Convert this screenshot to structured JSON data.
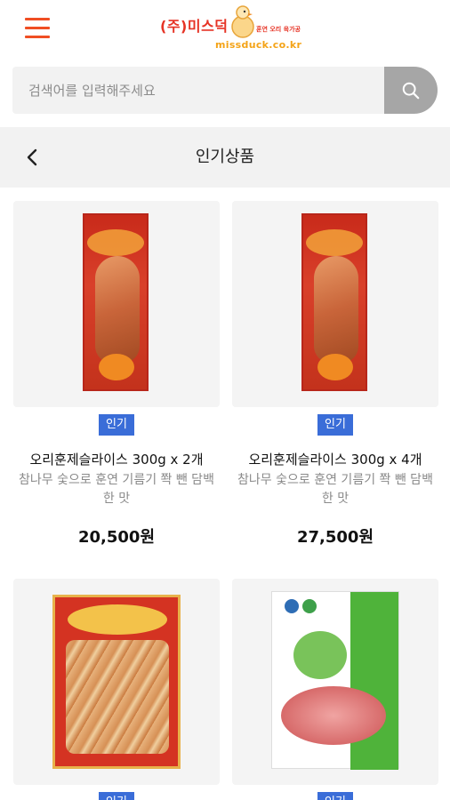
{
  "header": {
    "menu_icon": "hamburger-icon",
    "logo_name": "(주)미스덕",
    "logo_url": "missduck.co.kr",
    "brand_color": "#f04e23"
  },
  "search": {
    "placeholder": "검색어를 입력해주세요",
    "value": "",
    "icon": "search-icon"
  },
  "title_bar": {
    "back_icon": "chevron-left-icon",
    "title": "인기상품"
  },
  "products": [
    {
      "badge": "인기",
      "name": "오리훈제슬라이스 300g x 2개",
      "description": "참나무 숯으로 훈연 기름기 쫙 뺀 담백한 맛",
      "price": "20,500원"
    },
    {
      "badge": "인기",
      "name": "오리훈제슬라이스 300g x 4개",
      "description": "참나무 숯으로 훈연 기름기 쫙 뺀 담백한 맛",
      "price": "27,500원"
    },
    {
      "badge": "인기",
      "name": "",
      "description": "",
      "price": ""
    },
    {
      "badge": "인기",
      "name": "",
      "description": "",
      "price": ""
    }
  ],
  "colors": {
    "badge": "#3a6dd8",
    "search_button": "#a6a6a6",
    "title_bar_bg": "#f2f2f2"
  }
}
